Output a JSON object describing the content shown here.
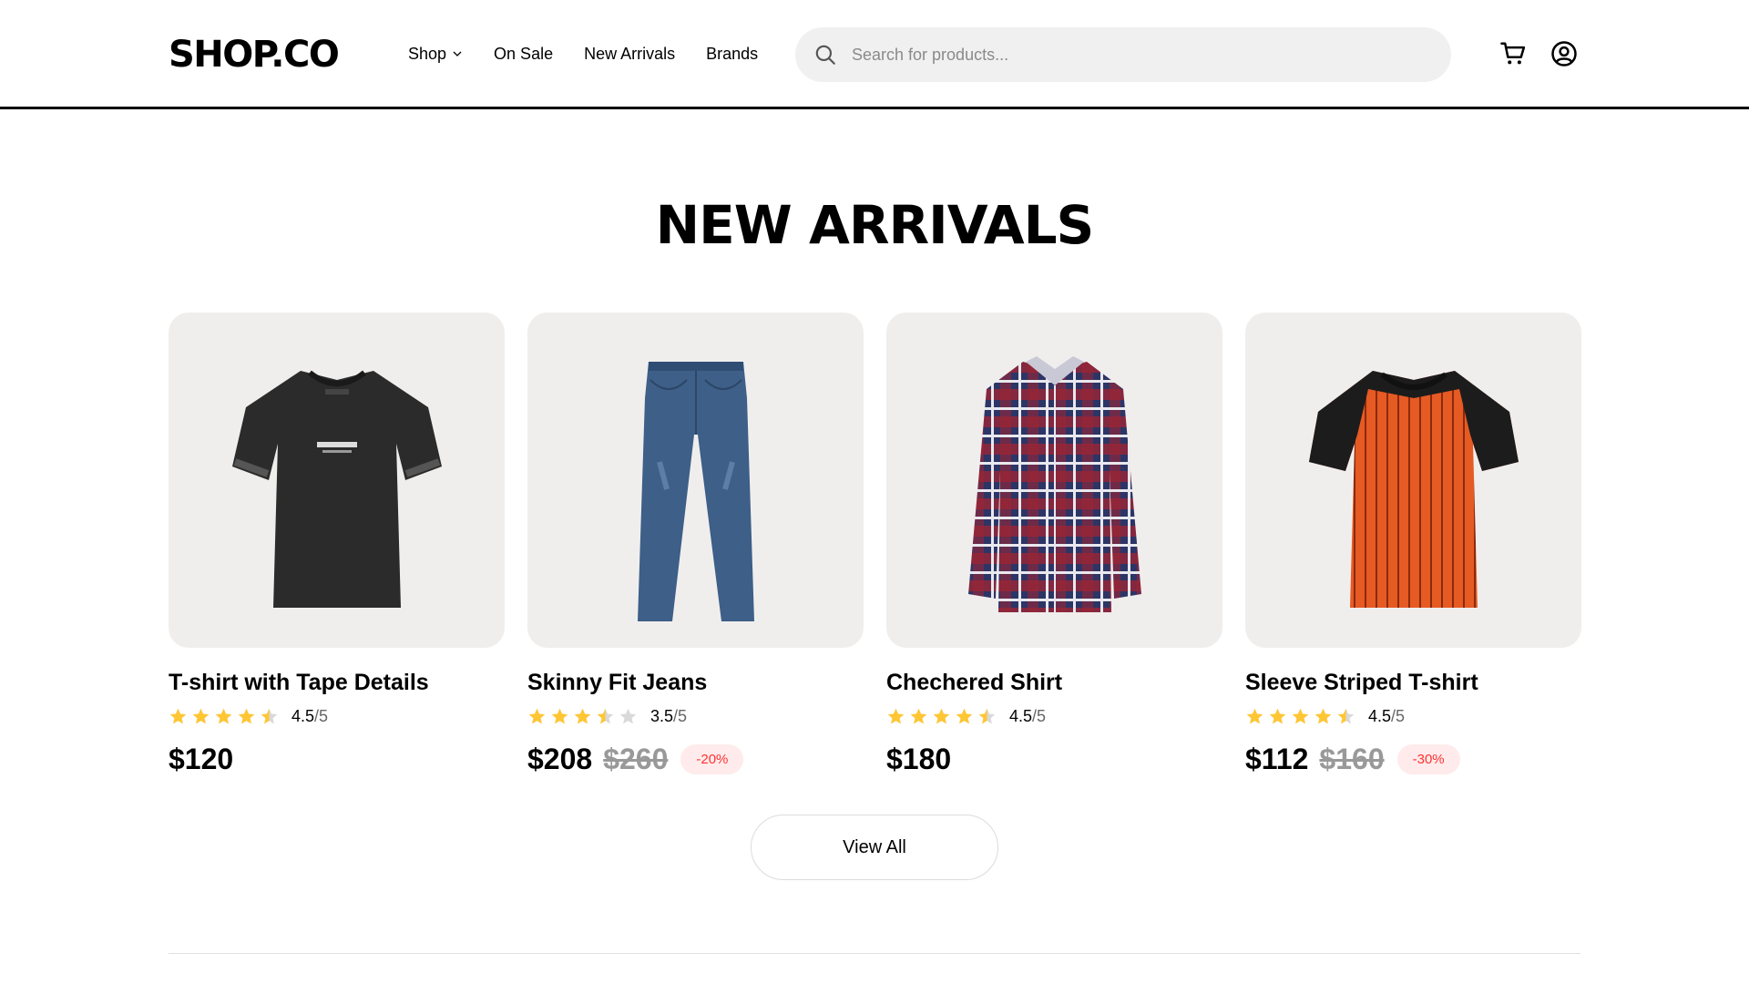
{
  "header": {
    "logo": "SHOP.CO",
    "nav": [
      {
        "label": "Shop",
        "has_dropdown": true
      },
      {
        "label": "On Sale"
      },
      {
        "label": "New Arrivals"
      },
      {
        "label": "Brands"
      }
    ],
    "search": {
      "placeholder": "Search for products...",
      "icon": "search-icon"
    },
    "icons": [
      "cart-icon",
      "account-icon"
    ]
  },
  "section": {
    "title": "NEW ARRIVALS"
  },
  "products": [
    {
      "name": "T-shirt with Tape Details",
      "rating": 4.5,
      "rating_value": "4.5",
      "rating_max": "/5",
      "price": "$120",
      "old_price": "",
      "discount": "",
      "image": "black-tshirt"
    },
    {
      "name": "Skinny Fit Jeans",
      "rating": 3.5,
      "rating_value": "3.5",
      "rating_max": "/5",
      "price": "$208",
      "old_price": "$260",
      "discount": "-20%",
      "image": "blue-jeans"
    },
    {
      "name": "Chechered Shirt",
      "rating": 4.5,
      "rating_value": "4.5",
      "rating_max": "/5",
      "price": "$180",
      "old_price": "",
      "discount": "",
      "image": "plaid-shirt"
    },
    {
      "name": "Sleeve Striped T-shirt",
      "rating": 4.5,
      "rating_value": "4.5",
      "rating_max": "/5",
      "price": "$112",
      "old_price": "$160",
      "discount": "-30%",
      "image": "striped-tshirt"
    }
  ],
  "view_all": "View All",
  "colors": {
    "star": "#ffc633",
    "star_empty": "#d9d9d9",
    "discount_text": "#ff3333",
    "discount_bg": "#ffebeb",
    "card_bg": "#f0eeed"
  }
}
